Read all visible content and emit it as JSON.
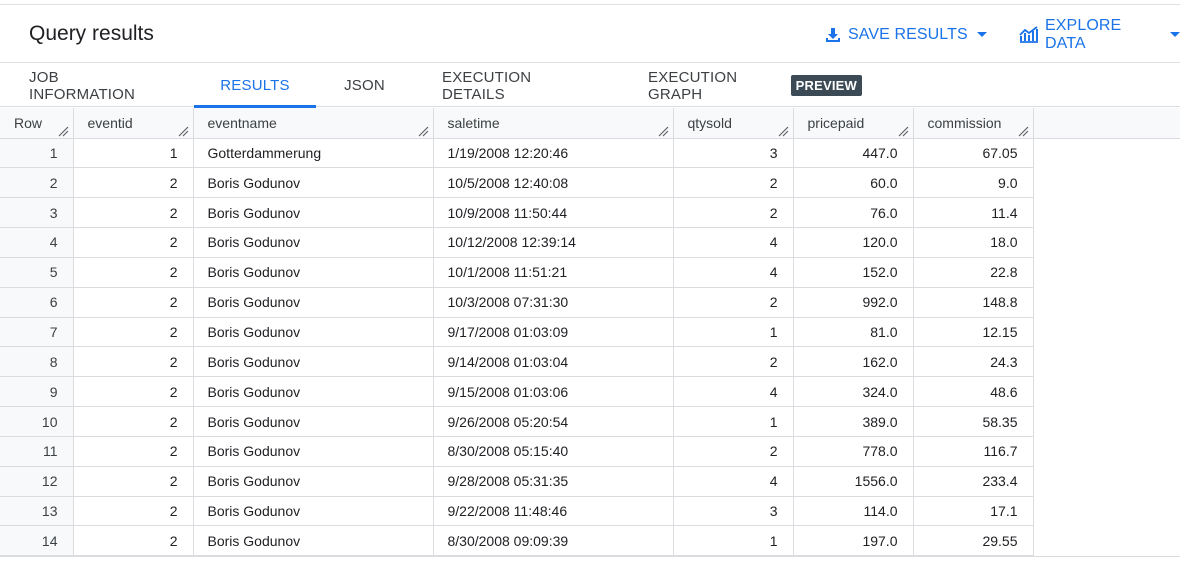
{
  "header": {
    "title": "Query results",
    "save_label": "SAVE RESULTS",
    "explore_label": "EXPLORE DATA"
  },
  "tabs": [
    {
      "label": "JOB INFORMATION",
      "active": false
    },
    {
      "label": "RESULTS",
      "active": true
    },
    {
      "label": "JSON",
      "active": false
    },
    {
      "label": "EXECUTION DETAILS",
      "active": false
    },
    {
      "label": "EXECUTION GRAPH",
      "active": false,
      "badge": "PREVIEW"
    }
  ],
  "colors": {
    "accent": "#1a73e8",
    "badge_bg": "#3c4a56",
    "border": "#dadce0",
    "header_bg": "#f8f9fa"
  },
  "icons": {
    "save": "download-icon",
    "explore": "chart-line-icon",
    "caret": "caret-down-icon",
    "resize": "column-resize-icon"
  },
  "table": {
    "columns": [
      "Row",
      "eventid",
      "eventname",
      "saletime",
      "qtysold",
      "pricepaid",
      "commission"
    ],
    "rows": [
      [
        "1",
        "1",
        "Gotterdammerung",
        "1/19/2008 12:20:46",
        "3",
        "447.0",
        "67.05"
      ],
      [
        "2",
        "2",
        "Boris Godunov",
        "10/5/2008 12:40:08",
        "2",
        "60.0",
        "9.0"
      ],
      [
        "3",
        "2",
        "Boris Godunov",
        "10/9/2008 11:50:44",
        "2",
        "76.0",
        "11.4"
      ],
      [
        "4",
        "2",
        "Boris Godunov",
        "10/12/2008 12:39:14",
        "4",
        "120.0",
        "18.0"
      ],
      [
        "5",
        "2",
        "Boris Godunov",
        "10/1/2008 11:51:21",
        "4",
        "152.0",
        "22.8"
      ],
      [
        "6",
        "2",
        "Boris Godunov",
        "10/3/2008 07:31:30",
        "2",
        "992.0",
        "148.8"
      ],
      [
        "7",
        "2",
        "Boris Godunov",
        "9/17/2008 01:03:09",
        "1",
        "81.0",
        "12.15"
      ],
      [
        "8",
        "2",
        "Boris Godunov",
        "9/14/2008 01:03:04",
        "2",
        "162.0",
        "24.3"
      ],
      [
        "9",
        "2",
        "Boris Godunov",
        "9/15/2008 01:03:06",
        "4",
        "324.0",
        "48.6"
      ],
      [
        "10",
        "2",
        "Boris Godunov",
        "9/26/2008 05:20:54",
        "1",
        "389.0",
        "58.35"
      ],
      [
        "11",
        "2",
        "Boris Godunov",
        "8/30/2008 05:15:40",
        "2",
        "778.0",
        "116.7"
      ],
      [
        "12",
        "2",
        "Boris Godunov",
        "9/28/2008 05:31:35",
        "4",
        "1556.0",
        "233.4"
      ],
      [
        "13",
        "2",
        "Boris Godunov",
        "9/22/2008 11:48:46",
        "3",
        "114.0",
        "17.1"
      ],
      [
        "14",
        "2",
        "Boris Godunov",
        "8/30/2008 09:09:39",
        "1",
        "197.0",
        "29.55"
      ]
    ]
  }
}
